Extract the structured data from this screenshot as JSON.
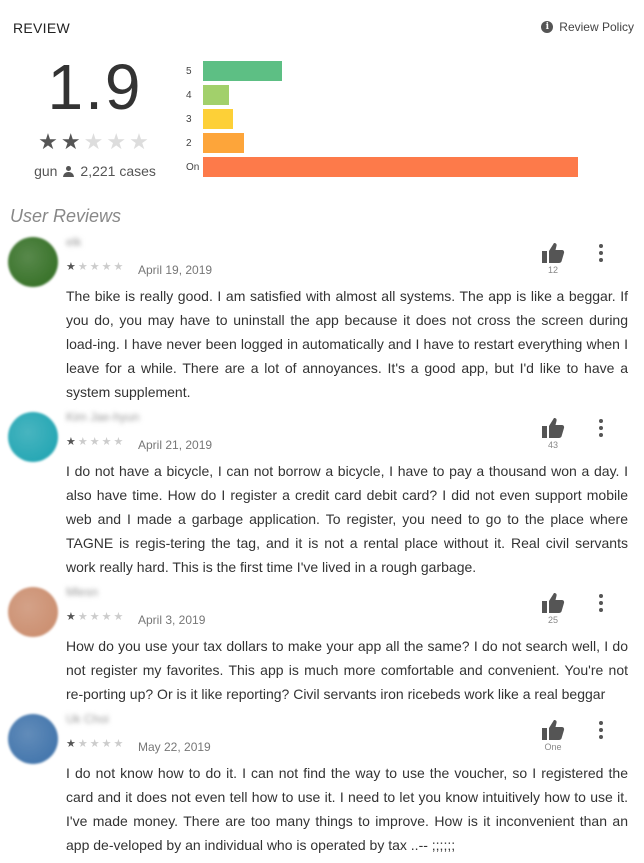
{
  "header": {
    "title": "REVIEW",
    "policy_label": "Review Policy",
    "policy_icon": "info-icon"
  },
  "summary": {
    "score": "1.9",
    "stars": 2,
    "rating_label": "gun",
    "count": "2,221 cases"
  },
  "histogram": [
    {
      "label": "5",
      "fraction": 0.21,
      "color": "#5dbf84"
    },
    {
      "label": "4",
      "fraction": 0.07,
      "color": "#a2d06b"
    },
    {
      "label": "3",
      "fraction": 0.08,
      "color": "#fdd037"
    },
    {
      "label": "2",
      "fraction": 0.11,
      "color": "#fda53a"
    },
    {
      "label": "On",
      "fraction": 1.0,
      "color": "#fd7a4a"
    }
  ],
  "section_title": "User Reviews",
  "reviews": [
    {
      "name": "elk",
      "date": "April 19, 2019",
      "stars": 1,
      "likes": "12",
      "avatar_color": "#2e6b1e",
      "text": "The bike is really good. I am satisfied with almost all systems. The app is like a beggar. If you do, you may have to uninstall the app because it does not cross the screen during load-ing. I have never been logged in automatically and I have to restart everything when I leave for a while. There are a lot of annoyances. It's a good app, but I'd like to have a system supplement."
    },
    {
      "name": "Kim Jae-hyun",
      "date": "April 21, 2019",
      "stars": 1,
      "likes": "43",
      "avatar_color": "#1aa2b0",
      "text": "I do not have a bicycle, I can not borrow a bicycle, I have to pay a thousand won a day. I also have time. How do I register a credit card debit card? I did not even support mobile web and I made a garbage application. To register, you need to go to the place where TAGNE is regis-tering the tag, and it is not a rental place without it. Real civil servants work really hard. This is the first time I've lived in a rough garbage."
    },
    {
      "name": "Mlesn",
      "date": "April 3, 2019",
      "stars": 1,
      "likes": "25",
      "avatar_color": "#c98a6a",
      "text": "How do you use your tax dollars to make your app all the same? I do not search well, I do not register my favorites. This app is much more comfortable and convenient. You're not re-porting up? Or is it like reporting? Civil servants iron ricebeds work like a real beggar"
    },
    {
      "name": "Uk Choi",
      "date": "May 22, 2019",
      "stars": 1,
      "likes": "One",
      "avatar_color": "#3a6fa8",
      "text": "I do not know how to do it. I can not find the way to use the voucher, so I registered the card and it does not even tell how to use it. I need to let you know intuitively how to use it. I've made money. There are too many things to improve. How is it inconvenient than an app de-veloped by an individual who is operated by tax ..-- ;;;;;;"
    }
  ]
}
